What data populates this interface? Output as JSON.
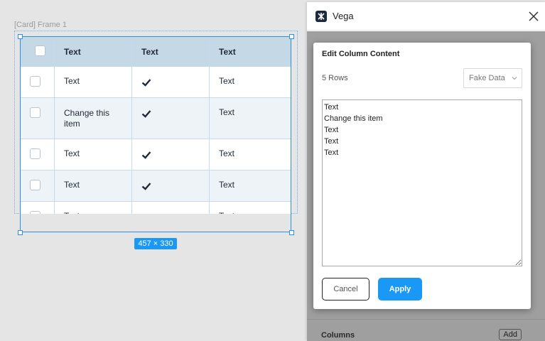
{
  "canvas": {
    "frame_label": "[Card] Frame 1",
    "dimensions": "457 × 330",
    "table": {
      "headers": [
        "Text",
        "Text",
        "Text"
      ],
      "rows": [
        {
          "a": "Text",
          "c": "Text"
        },
        {
          "a": "Change this item",
          "c": "Text"
        },
        {
          "a": "Text",
          "c": "Text"
        },
        {
          "a": "Text",
          "c": "Text"
        },
        {
          "a": "Text",
          "c": "Text"
        }
      ]
    }
  },
  "plugin": {
    "title": "Vega",
    "section_title": "Columns",
    "add_label": "Add"
  },
  "modal": {
    "title": "Edit Column Content",
    "rows_label": "5 Rows",
    "data_source": "Fake Data",
    "content": "Text\nChange this item\nText\nText\nText",
    "cancel_label": "Cancel",
    "apply_label": "Apply"
  },
  "colors": {
    "accent": "#1a98f5",
    "header_bg": "#c5d8e6",
    "row_alt_bg": "#eef3f7"
  }
}
